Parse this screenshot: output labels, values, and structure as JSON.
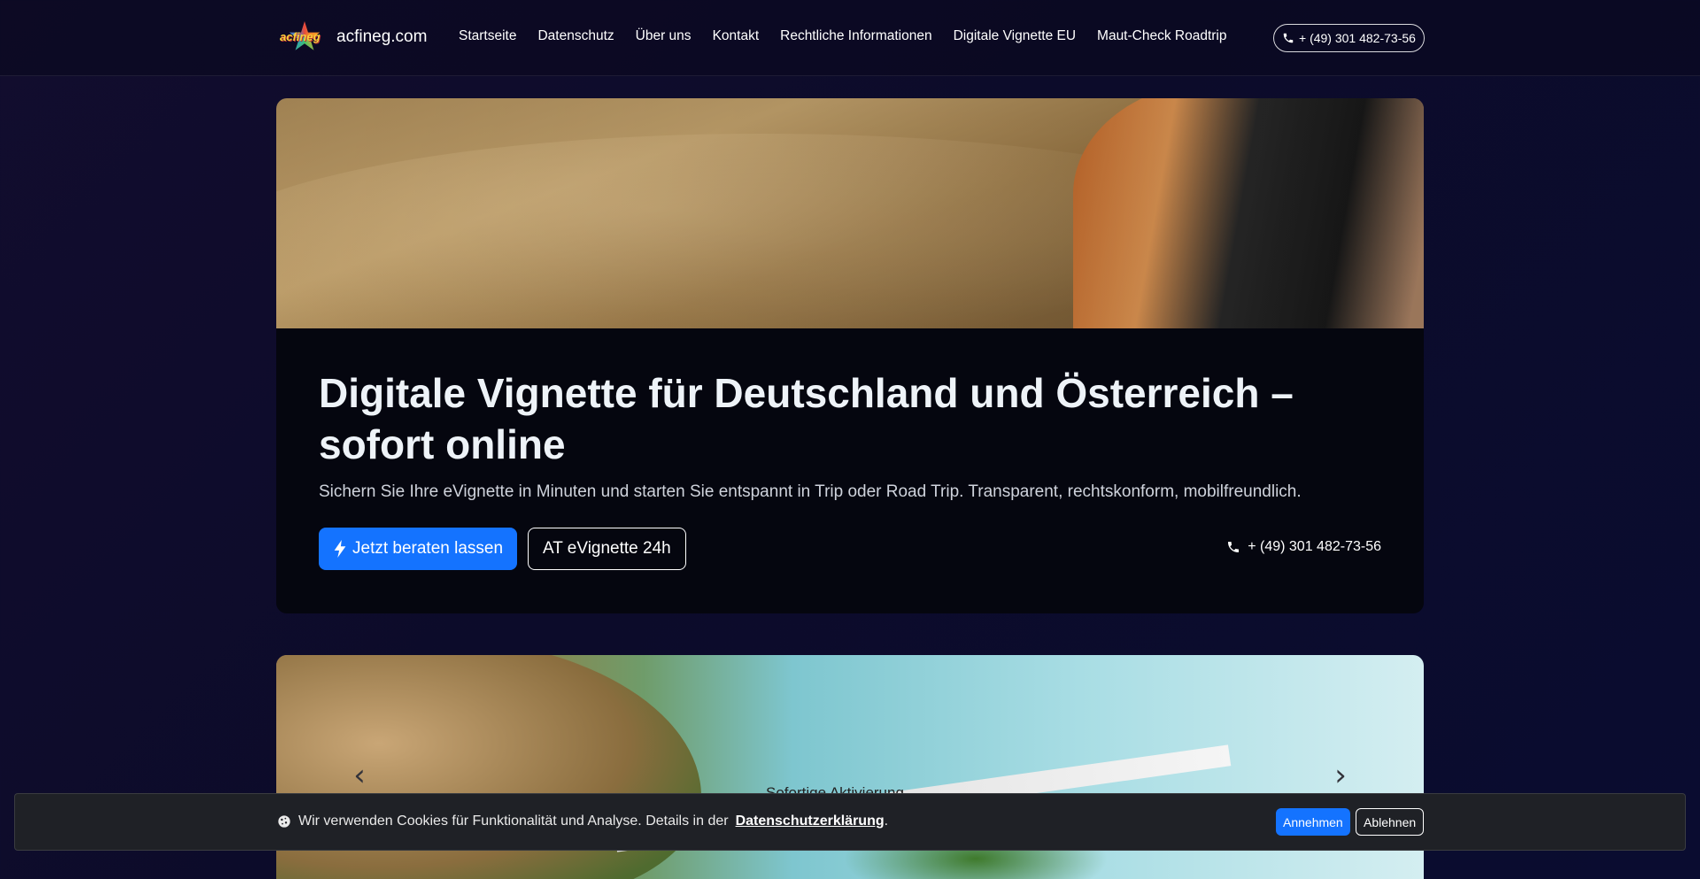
{
  "header": {
    "logo_text": "acfineg",
    "brand": "acfineg.com",
    "nav": [
      "Startseite",
      "Datenschutz",
      "Über uns",
      "Kontakt",
      "Rechtliche Informationen",
      "Digitale Vignette EU",
      "Maut-Check Roadtrip"
    ],
    "phone": "+ (49) 301 482-73-56"
  },
  "hero": {
    "title": "Digitale Vignette für Deutschland und Österreich – sofort online",
    "subtitle": "Sichern Sie Ihre eVignette in Minuten und starten Sie entspannt in Trip oder Road Trip. Transparent, rechtskonform, mobilfreundlich.",
    "primary_button": "Jetzt beraten lassen",
    "secondary_button": "AT eVignette 24h",
    "phone": "+ (49) 301 482-73-56"
  },
  "carousel": {
    "caption": "Sofortige Aktivierung",
    "prev_icon": "chevron-left-icon",
    "next_icon": "chevron-right-icon"
  },
  "cookie": {
    "text": "Wir verwenden Cookies für Funktionalität und Analyse. Details in der",
    "link": "Datenschutzerklärung",
    "suffix": ".",
    "accept": "Annehmen",
    "decline": "Ablehnen"
  },
  "colors": {
    "accent": "#1473ff",
    "background": "#0c0b2a",
    "panel": "#05060f",
    "cookie_bg": "#1f2126"
  }
}
